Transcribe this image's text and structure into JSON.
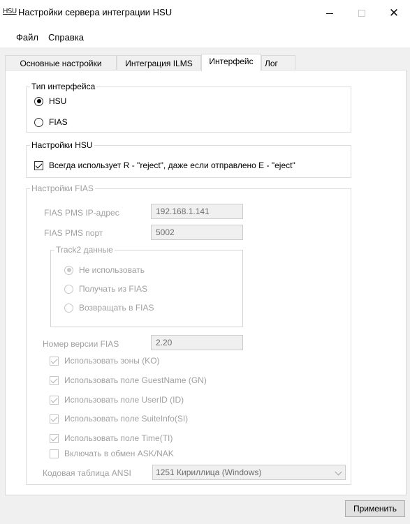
{
  "window": {
    "icon_text": "HSU",
    "title": "Настройки сервера интеграции HSU",
    "minimize_symbol": "—",
    "close_symbol": "✕"
  },
  "menu": {
    "file": "Файл",
    "help": "Справка"
  },
  "tabs": [
    {
      "label": "Основные настройки",
      "active": false
    },
    {
      "label": "Интеграция ILMS",
      "active": false
    },
    {
      "label": "Интерфейс",
      "active": true
    },
    {
      "label": "Лог",
      "active": false
    }
  ],
  "interface_type": {
    "legend": "Тип интерфейса",
    "options": [
      {
        "label": "HSU",
        "checked": true
      },
      {
        "label": "FIAS",
        "checked": false
      }
    ]
  },
  "hsu_settings": {
    "legend": "Настройки HSU",
    "always_reject_label": "Всегда использует R - \"reject\", даже если отправлено E - \"eject\"",
    "always_reject_checked": true
  },
  "fias_settings": {
    "legend": "Настройки FIAS",
    "enabled": false,
    "ip_label": "FIAS PMS IP-адрес",
    "ip_value": "192.168.1.141",
    "port_label": "FIAS PMS порт",
    "port_value": "5002",
    "track2": {
      "legend": "Track2 данные",
      "options": [
        {
          "label": "Не использовать",
          "checked": true
        },
        {
          "label": "Получать из FIAS",
          "checked": false
        },
        {
          "label": "Возвращать в FIAS",
          "checked": false
        }
      ]
    },
    "version_label": "Номер версии FIAS",
    "version_value": "2.20",
    "checkboxes": [
      {
        "label": "Использовать зоны (KO)",
        "checked": true
      },
      {
        "label": "Использовать поле GuestName (GN)",
        "checked": true
      },
      {
        "label": "Использовать поле UserID (ID)",
        "checked": true
      },
      {
        "label": "Использовать поле SuiteInfo(SI)",
        "checked": true
      },
      {
        "label": "Использовать поле Time(TI)",
        "checked": true
      },
      {
        "label": "Включать в обмен ASK/NAK",
        "checked": false
      }
    ],
    "codepage_label": "Кодовая таблица ANSI",
    "codepage_value": "1251 Кириллица (Windows)"
  },
  "apply_button": "Применить"
}
